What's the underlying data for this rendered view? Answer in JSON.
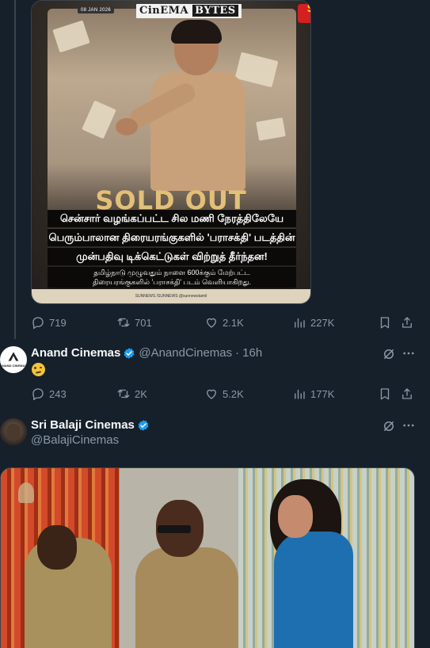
{
  "poster": {
    "date_badge": "08 JAN 2026",
    "brand_part1": "CinEMA",
    "brand_part2": "BYTES",
    "channel_line1": "SUN",
    "channel_line2": "NEWS",
    "headline": "SOLD OUT",
    "line1": "சென்சார் வழங்கப்பட்ட சில மணி நேரத்திலேயே",
    "line2": "பெரும்பாலான திரையரங்குகளில் 'பராசக்தி' படத்தின்",
    "line3": "முன்பதிவு டிக்கெட்டுகள் விற்றுத் தீர்ந்தன!",
    "line4a": "தமிழ்நாடு முழுவதும் நாளை 600க்கும் மேற்பட்ட",
    "line4b": "திரையரங்குகளில் 'பராசக்தி' படம் வெளியாகிறது.",
    "footer": "SUNNEWS  /SUNNEWS  @sunnewstamil"
  },
  "tweet1_actions": {
    "replies": "719",
    "retweets": "701",
    "likes": "2.1K",
    "views": "227K"
  },
  "tweet2": {
    "name": "Anand Cinemas",
    "handle": "@AnandCinemas",
    "separator": "·",
    "time": "16h",
    "avatar_text": "ANAND CINEMAS",
    "emoji": "face-with-raised-eyebrow",
    "actions": {
      "replies": "243",
      "retweets": "2K",
      "likes": "5.2K",
      "views": "177K"
    }
  },
  "tweet3": {
    "name": "Sri Balaji Cinemas",
    "handle": "@BalajiCinemas"
  },
  "colors": {
    "bg": "#15202b",
    "muted": "#8b98a5",
    "verified": "#1d9bf0",
    "border": "#38444d"
  }
}
